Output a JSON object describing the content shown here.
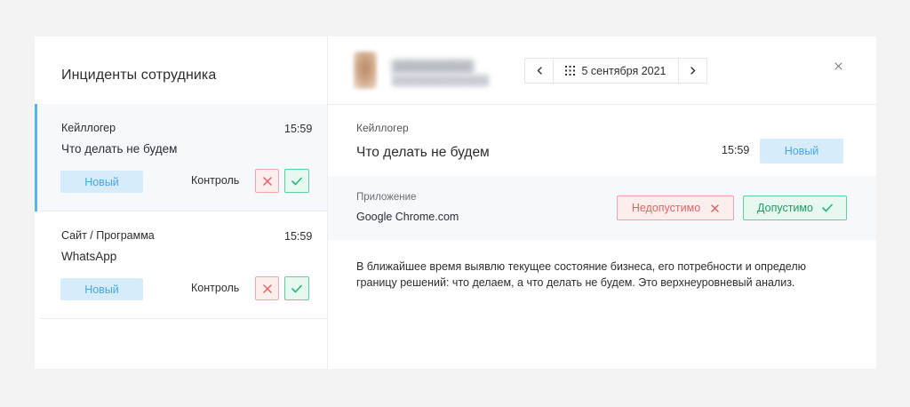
{
  "sidebar": {
    "title": "Инциденты сотрудника",
    "incidents": [
      {
        "type": "Кейллогер",
        "time": "15:59",
        "text": "Что делать не будем",
        "status": "Новый",
        "control_label": "Контроль",
        "reject_icon": "close-icon",
        "approve_icon": "check-icon",
        "active": true
      },
      {
        "type": "Сайт / Программа",
        "time": "15:59",
        "text": "WhatsApp",
        "status": "Новый",
        "control_label": "Контроль",
        "reject_icon": "close-icon",
        "approve_icon": "check-icon",
        "active": false
      }
    ]
  },
  "header": {
    "date": "5 сентября 2021",
    "prev_icon": "chevron-left-icon",
    "next_icon": "chevron-right-icon",
    "calendar_icon": "calendar-icon",
    "close_icon": "close-icon"
  },
  "detail": {
    "type": "Кейллогер",
    "title": "Что делать не будем",
    "time": "15:59",
    "status": "Новый",
    "app_label": "Приложение",
    "app_name": "Google Chrome.com",
    "deny_label": "Недопустимо",
    "allow_label": "Допустимо",
    "description": "В ближайшее время выявлю текущее состояние бизнеса, его потребности и определю границу решений: что делаем, а что делать не будем. Это верхнеуровневый анализ."
  },
  "colors": {
    "accent": "#55b6ee",
    "status_new_bg": "#d6ecfb",
    "status_new_text": "#4ba6e4",
    "deny": "#e56262",
    "allow": "#28b573"
  }
}
